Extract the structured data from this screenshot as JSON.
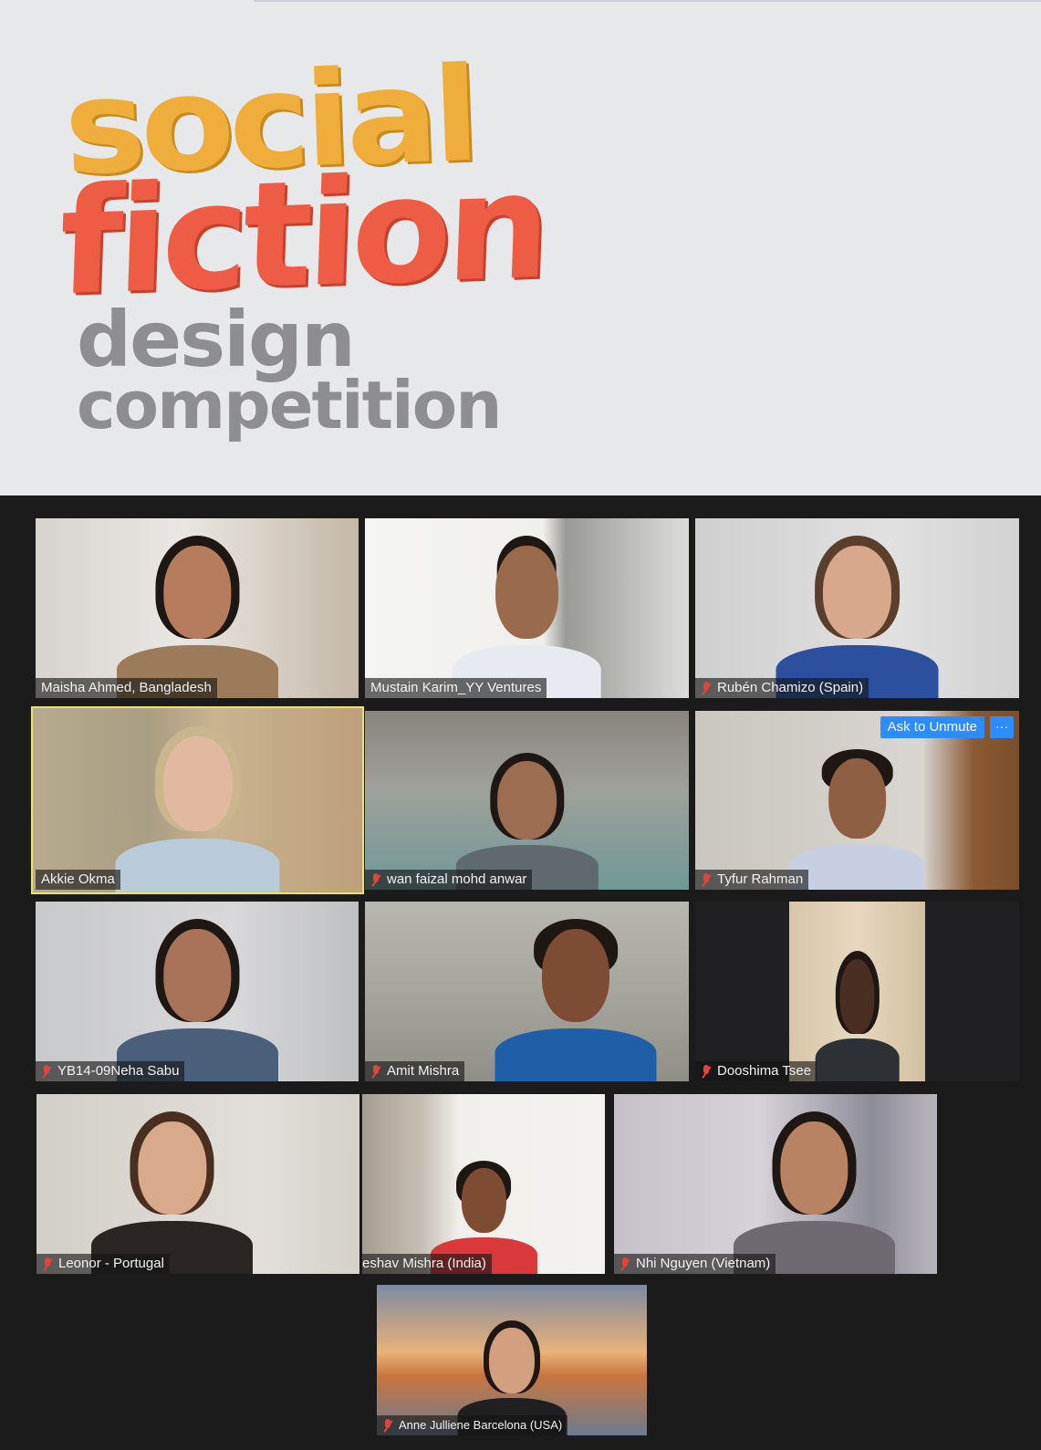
{
  "logo": {
    "line1": "social",
    "line2": "fiction",
    "line3": "design",
    "line4": "competition",
    "colors": {
      "social": "#efae3c",
      "fiction": "#ef5c45",
      "grey": "#8e8e90"
    }
  },
  "meeting": {
    "ask_to_unmute_label": "Ask to Unmute",
    "more_label": "···",
    "participants": [
      {
        "name": "Maisha Ahmed, Bangladesh",
        "muted": false
      },
      {
        "name": "Mustain Karim_YY Ventures",
        "muted": false
      },
      {
        "name": "Rubén Chamizo (Spain)",
        "muted": true
      },
      {
        "name": "Akkie Okma",
        "muted": false,
        "active_speaker": true
      },
      {
        "name": "wan faizal mohd anwar",
        "muted": true
      },
      {
        "name": "Tyfur Rahman",
        "muted": true
      },
      {
        "name": "YB14-09Neha Sabu",
        "muted": true
      },
      {
        "name": "Amit Mishra",
        "muted": true
      },
      {
        "name": "Dooshima Tsee",
        "muted": true
      },
      {
        "name": "Leonor - Portugal",
        "muted": true
      },
      {
        "name": "eshav Mishra (India)",
        "muted": false
      },
      {
        "name": "Nhi Nguyen (Vietnam)",
        "muted": true
      },
      {
        "name": "Anne Julliene Barcelona (USA)",
        "muted": true
      }
    ],
    "colors": {
      "muted_icon": "#e0443a",
      "button": "#2d8cff",
      "active_border": "#e9e36b"
    }
  }
}
